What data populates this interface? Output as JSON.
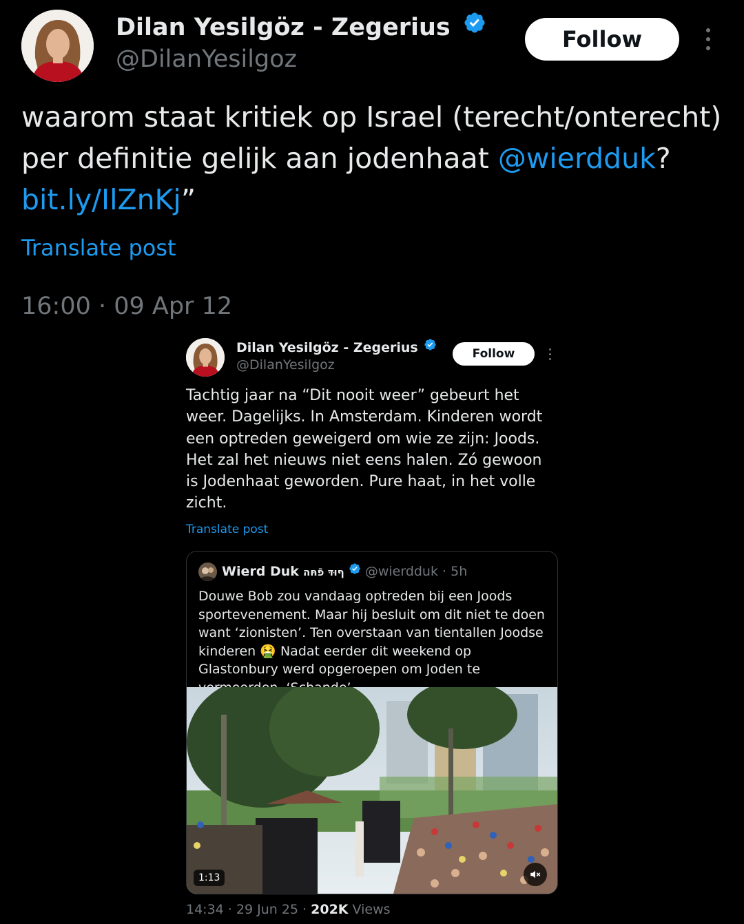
{
  "main_post": {
    "author_name": "Dilan Yesilgöz - Zegerius",
    "author_handle": "@DilanYesilgoz",
    "follow_label": "Follow",
    "text_part1": "waarom staat kritiek op Israel (terecht/onterecht) per definitie gelijk aan jodenhaat ",
    "mention": "@wierdduk",
    "text_part2": "?",
    "url": "bit.ly/IlZnKj",
    "url_suffix": "”",
    "translate_label": "Translate post",
    "timestamp": "16:00 · 09 Apr 12"
  },
  "embedded_post": {
    "author_name": "Dilan Yesilgöz - Zegerius",
    "author_handle": "@DilanYesilgoz",
    "follow_label": "Follow",
    "text": "Tachtig jaar na “Dit nooit weer” gebeurt het weer. Dagelijks. In Amsterdam. Kinderen wordt een optreden geweigerd om wie ze zijn: Joods. Het zal het nieuws niet eens halen. Zó gewoon is Jodenhaat geworden. Pure haat, in het volle zicht.",
    "translate_label": "Translate post",
    "quoted": {
      "author_name": "Wierd Duk",
      "author_suffix": "ףוּדּ פֿחּה",
      "author_handle": "@wierdduk",
      "time": "· 5h",
      "text_before_emoji": "Douwe Bob zou vandaag optreden bij een Joods sportevenement. Maar hij besluit om dit niet te doen want ‘zionisten’. Ten overstaan van tientallen Joodse kinderen ",
      "emoji": "🤮",
      "text_after_emoji": " Nadat eerder dit weekend op Glastonbury werd opgeroepen om Joden te vermoorden. ‘Schande’ …",
      "video_duration": "1:13"
    },
    "footer_time": "14:34 · 29 Jun 25 · ",
    "views_count": "202K",
    "views_label": " Views"
  },
  "icons": {
    "verified": "verified-badge-icon",
    "more": "more-options-icon",
    "mute": "muted-speaker-icon"
  },
  "colors": {
    "background": "#000000",
    "text": "#e7e9ea",
    "secondary": "#71767b",
    "link": "#1d9bf0",
    "verified": "#1d9bf0"
  }
}
